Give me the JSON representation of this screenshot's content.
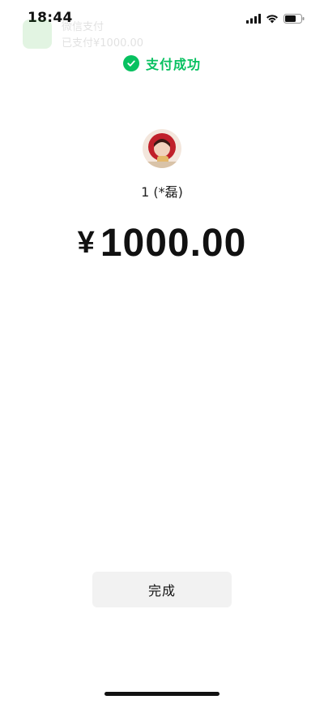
{
  "status_bar": {
    "time": "18:44",
    "icons": [
      "cellular-signal-icon",
      "wifi-icon",
      "battery-icon"
    ]
  },
  "notification": {
    "title": "微信支付",
    "body": "已支付¥1000.00"
  },
  "result": {
    "status_text": "支付成功",
    "status_icon": "check-circle-icon",
    "status_color": "#07c160"
  },
  "payee": {
    "name": "1 (*磊)",
    "avatar": "profile-photo"
  },
  "payment": {
    "currency_symbol": "¥",
    "amount": "1000.00"
  },
  "actions": {
    "done_label": "完成"
  }
}
